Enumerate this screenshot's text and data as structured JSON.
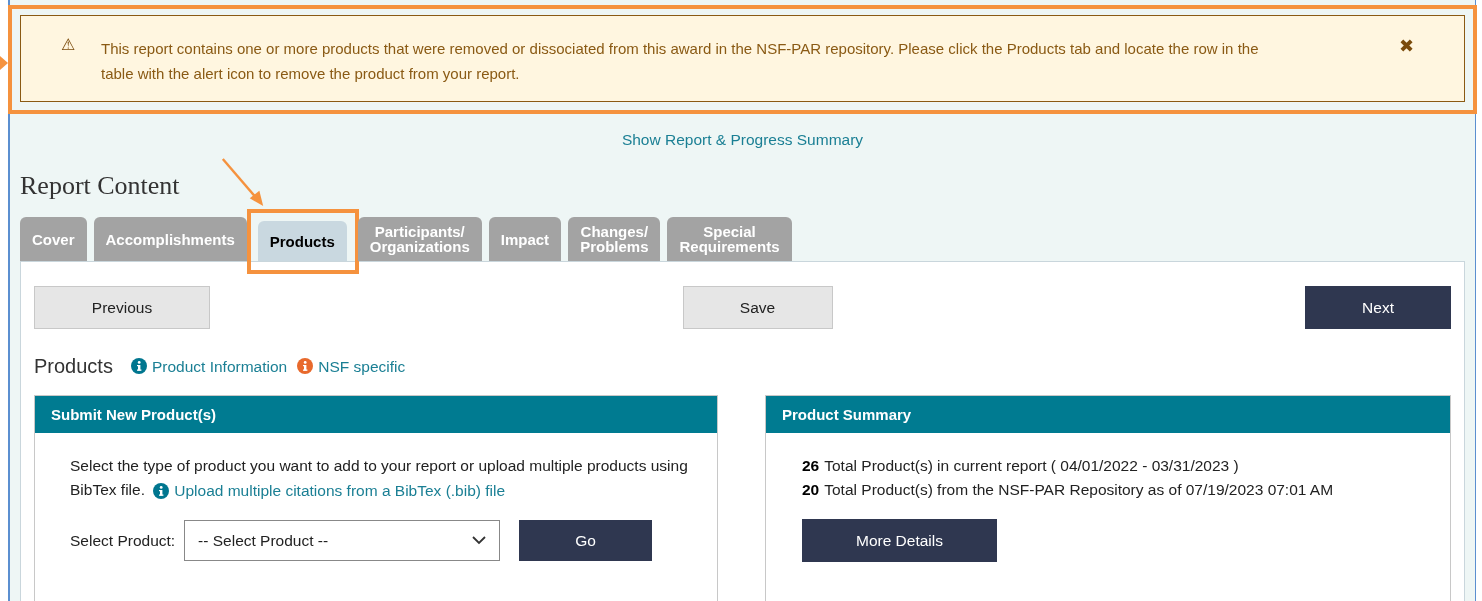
{
  "alert": {
    "icon": "⚠",
    "message": "This report contains one or more products that were removed or dissociated from this award in the NSF-PAR repository. Please click the Products tab and locate the row in the table with the alert icon to remove the product from your report.",
    "close": "✖"
  },
  "summary_link": "Show Report & Progress Summary",
  "heading": "Report Content",
  "tabs": [
    {
      "label": "Cover",
      "selected": false
    },
    {
      "label": "Accomplishments",
      "selected": false
    },
    {
      "label": "Products",
      "selected": true
    },
    {
      "label": "Participants/\nOrganizations",
      "selected": false
    },
    {
      "label": "Impact",
      "selected": false
    },
    {
      "label": "Changes/\nProblems",
      "selected": false
    },
    {
      "label": "Special\nRequirements",
      "selected": false
    }
  ],
  "nav": {
    "previous": "Previous",
    "save": "Save",
    "next": "Next"
  },
  "section": {
    "title": "Products",
    "links": [
      {
        "label": "Product Information",
        "color": "#00768f"
      },
      {
        "label": "NSF specific",
        "color": "#e8692c"
      }
    ]
  },
  "submit_panel": {
    "title": "Submit New Product(s)",
    "text": "Select the type of product you want to add to your report or upload multiple products using BibTex file.",
    "link": "Upload multiple citations from a BibTex (.bib) file",
    "select_label": "Select Product:",
    "select_value": "-- Select Product --",
    "go": "Go"
  },
  "summary_panel": {
    "title": "Product Summary",
    "lines": [
      {
        "count": "26",
        "text": "Total Product(s) in current report ( 04/01/2022 - 03/31/2023 )"
      },
      {
        "count": "20",
        "text": "Total Product(s) from the NSF-PAR Repository as of 07/19/2023 07:01 AM"
      }
    ],
    "button": "More Details"
  }
}
